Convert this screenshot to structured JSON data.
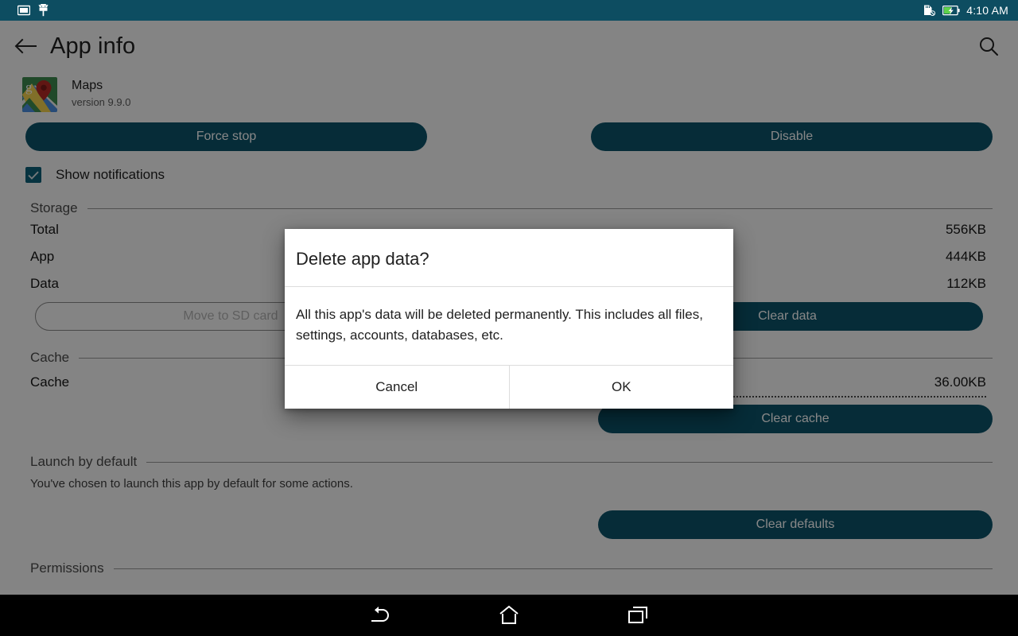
{
  "status_bar": {
    "left_icons": [
      "screenshot-icon",
      "android-debug-icon"
    ],
    "sdcard_icon": "sdcard-off-icon",
    "battery_icon": "battery-charging-icon",
    "time": "4:10 AM",
    "background_color": "#0d4d61"
  },
  "action_bar": {
    "back_icon": "back-arrow-icon",
    "title": "App info",
    "search_icon": "search-icon"
  },
  "app": {
    "icon": "google-maps-icon",
    "name": "Maps",
    "version": "version 9.9.0"
  },
  "top_buttons": {
    "force_stop": "Force stop",
    "disable": "Disable"
  },
  "notifications": {
    "label": "Show notifications",
    "checked": true
  },
  "storage": {
    "section_label": "Storage",
    "rows": [
      {
        "key": "Total",
        "value": "556KB"
      },
      {
        "key": "App",
        "value": "444KB"
      },
      {
        "key": "Data",
        "value": "112KB"
      }
    ],
    "move_button": "Move to SD card",
    "clear_data_button": "Clear data"
  },
  "cache": {
    "section_label": "Cache",
    "row": {
      "key": "Cache",
      "value": "36.00KB"
    },
    "clear_cache_button": "Clear cache"
  },
  "launch_by_default": {
    "section_label": "Launch by default",
    "description": "You've chosen to launch this app by default for some actions.",
    "clear_defaults_button": "Clear defaults"
  },
  "permissions": {
    "section_label": "Permissions"
  },
  "dialog": {
    "title": "Delete app data?",
    "message": "All this app's data will be deleted permanently. This includes all files, settings, accounts, databases, etc.",
    "cancel_label": "Cancel",
    "ok_label": "OK"
  },
  "nav_bar": {
    "back_icon": "nav-back-icon",
    "home_icon": "nav-home-icon",
    "recents_icon": "nav-recents-icon"
  },
  "colors": {
    "accent": "#0d546b",
    "status_bar": "#0d4d61",
    "checkbox": "#0d6079"
  }
}
